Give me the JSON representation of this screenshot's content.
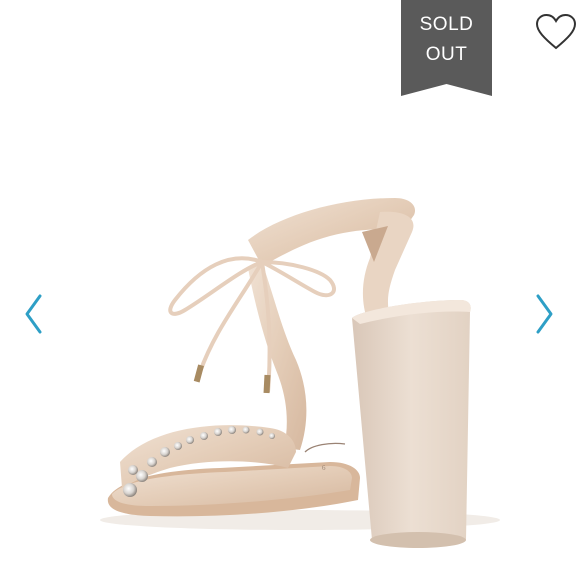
{
  "listing": {
    "status_badge": {
      "line1": "SOLD",
      "line2": "OUT",
      "color": "#5a5a5a"
    },
    "photo": {
      "subject": "sandal-photo"
    },
    "controls": {
      "like_icon": "heart-outline-icon",
      "prev_icon": "chevron-left-icon",
      "next_icon": "chevron-right-icon",
      "arrow_color": "#2e9fc6"
    }
  }
}
